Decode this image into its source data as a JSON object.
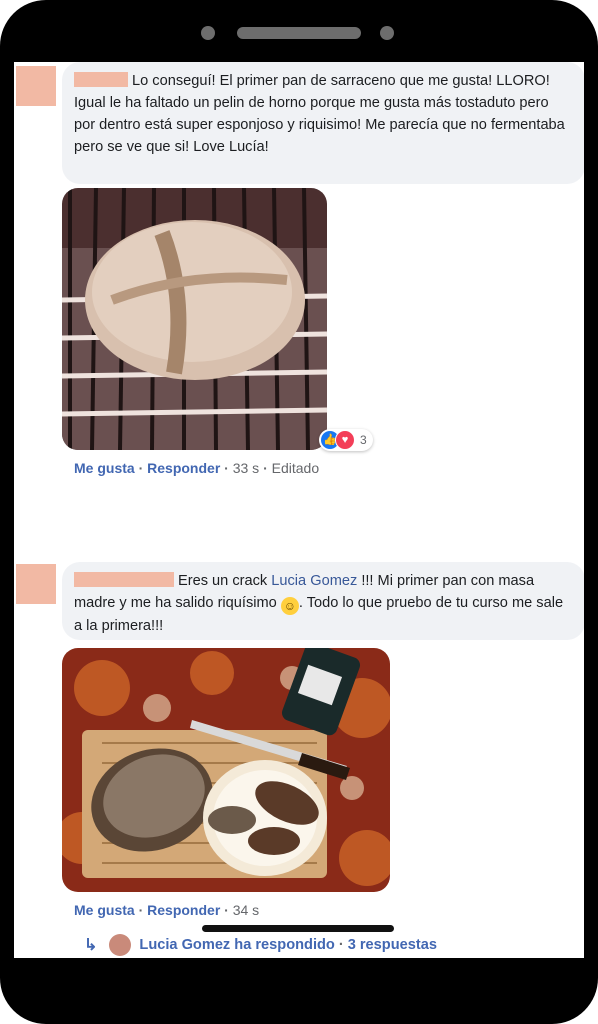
{
  "comments": [
    {
      "text": "Lo conseguí! El primer pan de sarraceno que me gusta! LLORO! Igual le ha faltado un pelin de horno porque me gusta más tostaduto pero por dentro está super esponjoso y riquisimo! Me parecía que no fermentaba pero se ve que si! Love Lucía!",
      "image": "buckwheat-loaf-on-rack",
      "reaction_count": "3",
      "like_label": "Me gusta",
      "reply_label": "Responder",
      "time": "33 s",
      "edited": "Editado"
    },
    {
      "text_before": "Eres un crack",
      "mention": "Lucia Gomez",
      "text_after": "!!! Mi primer pan con masa madre y me ha salido riquísimo",
      "text_end": ". Todo lo que pruebo de tu curso me sale a la primera!!!",
      "image": "sourdough-loaf-on-board",
      "like_label": "Me gusta",
      "reply_label": "Responder",
      "time": "34 s",
      "replies_text": "Lucia Gomez ha respondido",
      "replies_count": "3 respuestas"
    }
  ],
  "colors": {
    "link": "#4267b2",
    "bubble": "#f0f2f5",
    "redaction": "#f2b9a4"
  }
}
